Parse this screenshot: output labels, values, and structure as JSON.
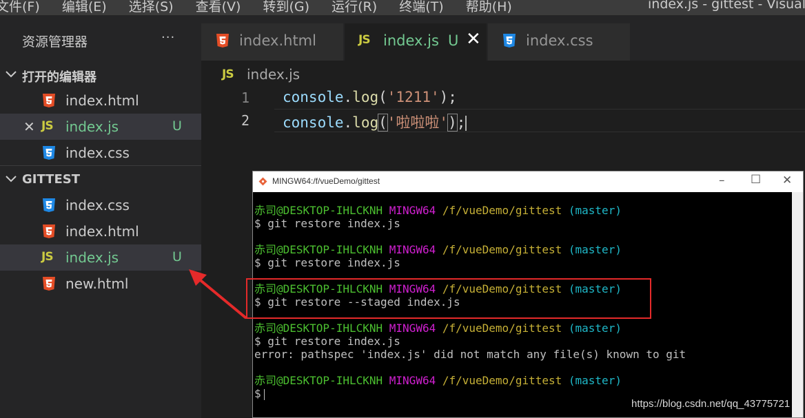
{
  "menubar": {
    "items": [
      "文件(F)",
      "编辑(E)",
      "选择(S)",
      "查看(V)",
      "转到(G)",
      "运行(R)",
      "终端(T)",
      "帮助(H)"
    ],
    "window_title": "index.js - gittest - Visual S"
  },
  "sidebar": {
    "title": "资源管理器",
    "more": "···",
    "open_editors": {
      "label": "打开的编辑器",
      "items": [
        {
          "name": "index.html",
          "icon": "html5-icon"
        },
        {
          "name": "index.js",
          "icon": "js-icon",
          "badge": "U"
        },
        {
          "name": "index.css",
          "icon": "css3-icon"
        }
      ]
    },
    "workspace": {
      "label": "GITTEST",
      "items": [
        {
          "name": "index.css",
          "icon": "css3-icon"
        },
        {
          "name": "index.html",
          "icon": "html5-icon"
        },
        {
          "name": "index.js",
          "icon": "js-icon",
          "badge": "U"
        },
        {
          "name": "new.html",
          "icon": "html5-icon"
        }
      ]
    }
  },
  "tabs": [
    {
      "name": "index.html",
      "icon": "html5-icon"
    },
    {
      "name": "index.js",
      "icon": "js-icon",
      "badge": "U",
      "active": true
    },
    {
      "name": "index.css",
      "icon": "css3-icon"
    }
  ],
  "icons": {
    "js_text": "JS"
  },
  "breadcrumb": {
    "file": "index.js"
  },
  "editor": {
    "line_numbers": [
      "1",
      "2"
    ],
    "lines": [
      {
        "obj": "console",
        "dot": ".",
        "fn": "log",
        "open": "(",
        "str": "'1211'",
        "close": ")",
        "end": ";"
      },
      {
        "obj": "console",
        "dot": ".",
        "fn": "log",
        "open": "(",
        "str": "'啦啦啦'",
        "close": ")",
        "end": ";"
      }
    ]
  },
  "terminal": {
    "title": "MINGW64:/f/vueDemo/gittest",
    "prompt": {
      "user": "赤司@DESKTOP-IHLCKNH",
      "system": "MINGW64",
      "path": "/f/vueDemo/gittest",
      "branch": "(master)"
    },
    "commands": [
      "$ git restore index.js",
      "$ git restore index.js",
      "$ git restore --staged index.js",
      "$ git restore index.js"
    ],
    "error": "error: pathspec 'index.js' did not match any file(s) known to git",
    "final_prompt": "$"
  },
  "watermark": "https://blog.csdn.net/qq_43775721",
  "colors": {
    "annotation": "#e52a2a",
    "untracked": "#73c991"
  }
}
